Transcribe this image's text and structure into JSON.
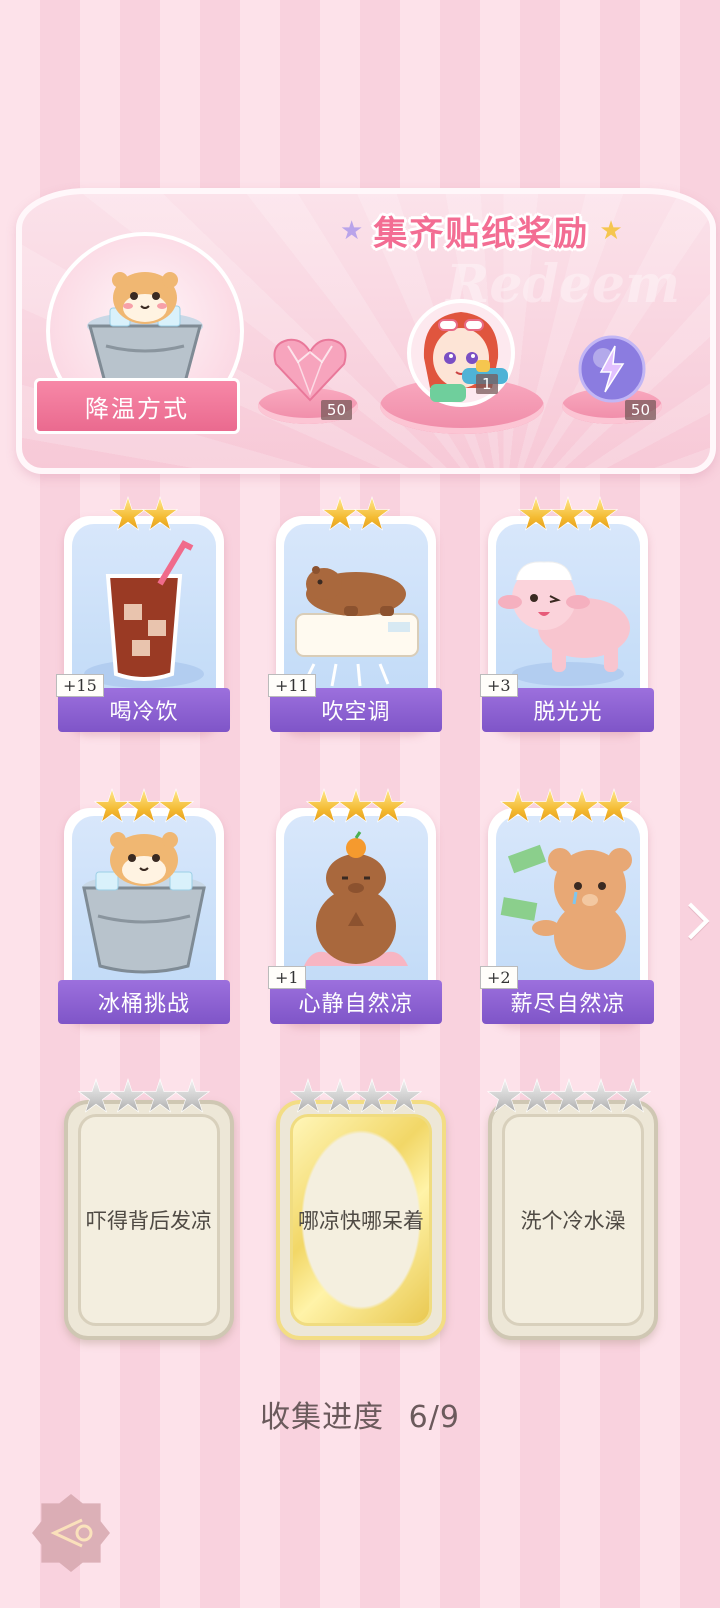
{
  "reward_panel": {
    "title": "集齐贴纸奖励",
    "watermark": "Redeem",
    "cooling_label": "降温方式",
    "rewards": [
      {
        "icon": "pink-heart-gem-icon",
        "count": "50"
      },
      {
        "icon": "character-avatar-water-gun",
        "count": "1"
      },
      {
        "icon": "lightning-orb-icon",
        "count": "50"
      }
    ]
  },
  "cards": [
    {
      "label": "喝冷饮",
      "count": "+15",
      "stars": 2,
      "icon": "iced-drink-icon"
    },
    {
      "label": "吹空调",
      "count": "+11",
      "stars": 2,
      "icon": "capybara-air-conditioner-icon"
    },
    {
      "label": "脱光光",
      "count": "+3",
      "stars": 3,
      "icon": "pink-sheep-icon"
    },
    {
      "label": "冰桶挑战",
      "count": "",
      "stars": 3,
      "icon": "hamster-ice-bucket-icon"
    },
    {
      "label": "心静自然凉",
      "count": "+1",
      "stars": 3,
      "icon": "capybara-meditating-icon"
    },
    {
      "label": "薪尽自然凉",
      "count": "+2",
      "stars": 4,
      "icon": "crying-bear-money-icon"
    }
  ],
  "locked_cards": [
    {
      "label": "吓得背后发凉",
      "stars": 4
    },
    {
      "label": "哪凉快哪呆着",
      "stars": 4
    },
    {
      "label": "洗个冷水澡",
      "stars": 5
    }
  ],
  "progress": {
    "label": "收集进度",
    "value": "6/9"
  },
  "colors": {
    "title_pink": "#f36d93",
    "label_purple": "#8b5fd2",
    "background_stripe": "#f9d2de"
  }
}
